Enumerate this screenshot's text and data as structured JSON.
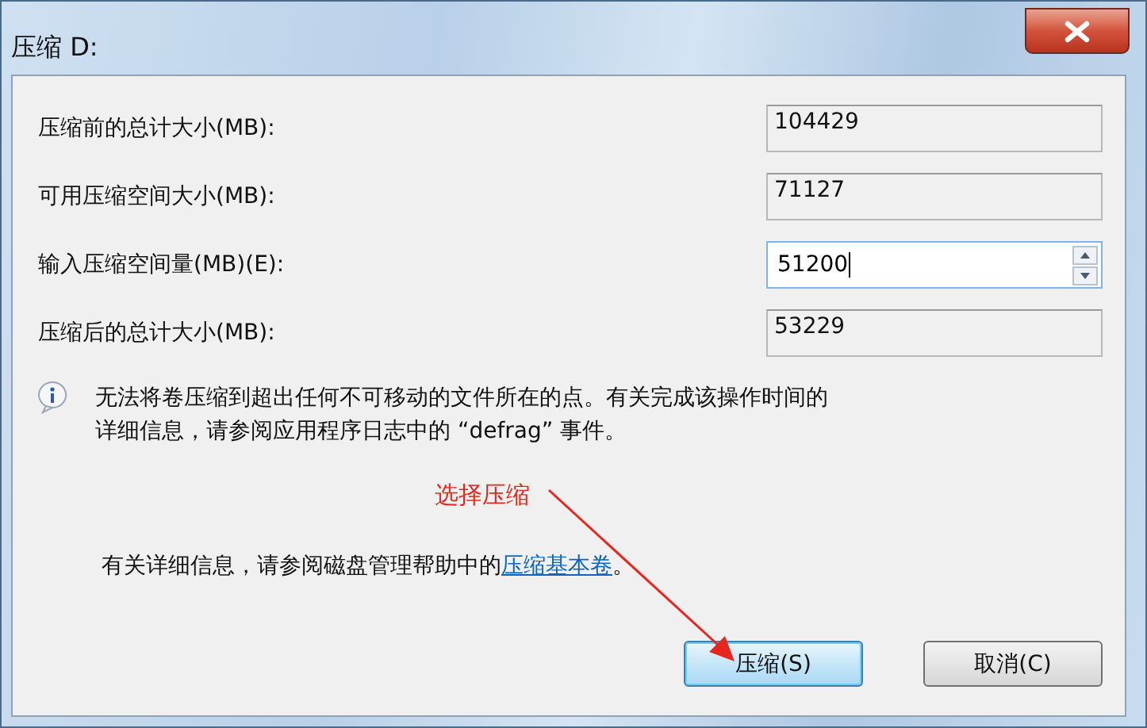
{
  "window": {
    "title": "压缩 D:"
  },
  "fields": [
    {
      "label": "压缩前的总计大小(MB):",
      "value": "104429",
      "kind": "readonly"
    },
    {
      "label": "可用压缩空间大小(MB):",
      "value": "71127",
      "kind": "readonly"
    },
    {
      "label": "输入压缩空间量(MB)(E):",
      "value": "51200",
      "kind": "spin"
    },
    {
      "label": "压缩后的总计大小(MB):",
      "value": "53229",
      "kind": "readonly"
    }
  ],
  "info": {
    "lines": [
      "无法将卷压缩到超出任何不可移动的文件所在的点。有关完成该操作时间的",
      "详细信息，请参阅应用程序日志中的 “defrag” 事件。"
    ]
  },
  "annotation": {
    "text": "选择压缩"
  },
  "help": {
    "before": "有关详细信息，请参阅磁盘管理帮助中的",
    "link": "压缩基本卷",
    "after": "。"
  },
  "buttons": [
    {
      "label": "压缩(S)",
      "default": true
    },
    {
      "label": "取消(C)",
      "default": false
    }
  ]
}
